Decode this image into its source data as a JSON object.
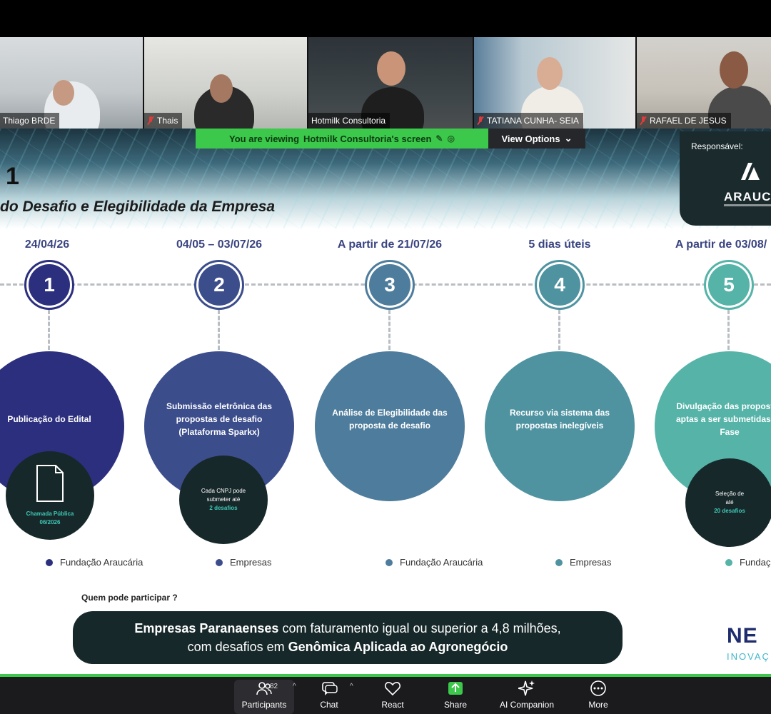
{
  "participants": [
    {
      "name": "Thiago BRDE",
      "muted": false
    },
    {
      "name": "Thais",
      "muted": true
    },
    {
      "name": "Hotmilk Consultoria",
      "muted": false
    },
    {
      "name": "TATIANA CUNHA- SEIA",
      "muted": true
    },
    {
      "name": "RAFAEL DE JESUS",
      "muted": true
    }
  ],
  "banner": {
    "viewing_text": "You are viewing",
    "presenter": "Hotmilk Consultoria's screen",
    "view_options": "View Options"
  },
  "slide": {
    "phase_number": "1",
    "phase_title": "do Desafio e Elegibilidade da Empresa",
    "responsible_label": "Responsável:",
    "responsible_logo": "ARAUC",
    "steps": [
      {
        "date": "24/04/26",
        "num": "1",
        "title": "Publicação do Edital",
        "sub_lines": [
          "Chamada Pública",
          "06/2026"
        ],
        "actor": "Fundação Araucária",
        "color": "#2c2f7e"
      },
      {
        "date": "04/05 – 03/07/26",
        "num": "2",
        "title": "Submissão eletrônica das propostas de desafio (Plataforma Sparkx)",
        "sub_lines": [
          "Cada CNPJ pode",
          "submeter até",
          "2 desafios"
        ],
        "actor": "Empresas",
        "color": "#3c4d8c"
      },
      {
        "date": "A partir de 21/07/26",
        "num": "3",
        "title": "Análise de Elegibilidade das proposta de desafio",
        "sub_lines": [],
        "actor": "Fundação Araucária",
        "color": "#4e7c9c"
      },
      {
        "date": "5 dias úteis",
        "num": "4",
        "title": "Recurso via sistema das propostas inelegíveis",
        "sub_lines": [],
        "actor": "Empresas",
        "color": "#4f93a1"
      },
      {
        "date": "A partir de 03/08/",
        "num": "5",
        "title": "Divulgação das propostas aptas a ser submetidas na Fase",
        "sub_lines": [
          "Seleção de",
          "até",
          "20 desafios"
        ],
        "actor": "Fundaç",
        "color": "#55b3a8"
      }
    ],
    "who_label": "Quem pode participar ?",
    "who_line1_bold": "Empresas Paranaenses",
    "who_line1_rest": " com faturamento igual ou superior a 4,8 milhões,",
    "who_line2_pre": "com desafios em ",
    "who_line2_bold": "Genômica Aplicada ao Agronegócio",
    "nex_logo": "NE",
    "nex_sub": "INOVAÇ"
  },
  "toolbar": {
    "participants_count": "82",
    "items": [
      {
        "label": "Participants",
        "icon": "participants-icon"
      },
      {
        "label": "Chat",
        "icon": "chat-icon"
      },
      {
        "label": "React",
        "icon": "heart-icon"
      },
      {
        "label": "Share",
        "icon": "share-icon"
      },
      {
        "label": "AI Companion",
        "icon": "sparkle-icon"
      },
      {
        "label": "More",
        "icon": "more-icon"
      }
    ]
  },
  "colors": {
    "accent_green": "#3cc84a",
    "dark_teal": "#17282a",
    "highlight_teal": "#3fc9b6"
  }
}
